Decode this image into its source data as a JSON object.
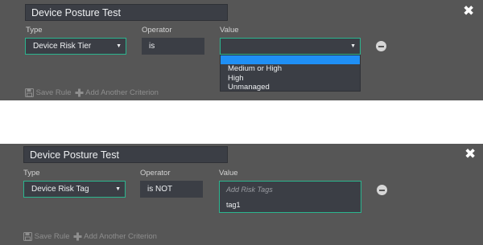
{
  "panels": [
    {
      "criterion_name": "Device Posture Test",
      "labels": {
        "type": "Type",
        "operator": "Operator",
        "value": "Value"
      },
      "type_value": "Device Risk Tier",
      "operator_value": "is",
      "value_selected": "",
      "dropdown_options": [
        "Medium or High",
        "High",
        "Unmanaged"
      ],
      "actions": {
        "save": "Save Rule",
        "add": "Add Another Criterion"
      }
    },
    {
      "criterion_name": "Device Posture Test",
      "labels": {
        "type": "Type",
        "operator": "Operator",
        "value": "Value"
      },
      "type_value": "Device Risk Tag",
      "operator_value": "is NOT",
      "tag_placeholder": "Add Risk Tags",
      "tags": [
        "tag1"
      ],
      "actions": {
        "save": "Save Rule",
        "add": "Add Another Criterion"
      }
    }
  ],
  "colors": {
    "panel_bg": "#565656",
    "field_bg": "#3b3e45",
    "accent_border": "#2bb58e",
    "dropdown_highlight": "#1f8ff5"
  },
  "icons": [
    "close-icon",
    "caret-down-icon",
    "minus-circle-icon",
    "save-icon",
    "plus-icon"
  ]
}
